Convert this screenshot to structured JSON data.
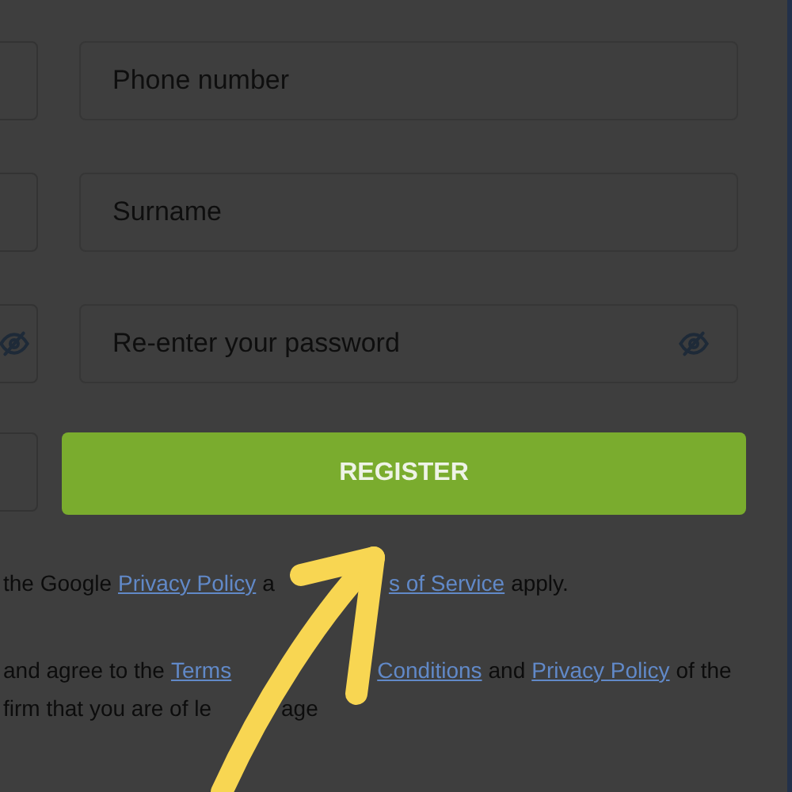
{
  "left_fields": [
    {
      "kind": "plain"
    },
    {
      "kind": "plain"
    },
    {
      "kind": "password"
    },
    {
      "kind": "plain"
    }
  ],
  "fields": [
    {
      "kind": "text",
      "placeholder": "Phone number"
    },
    {
      "kind": "text",
      "placeholder": "Surname"
    },
    {
      "kind": "password",
      "placeholder": "Re-enter your password"
    }
  ],
  "register_button": "REGISTER",
  "notes": [
    [
      {
        "kind": "text",
        "text": "the Google"
      },
      {
        "kind": "link",
        "text": "Privacy Policy"
      },
      {
        "kind": "text",
        "text": "a"
      },
      {
        "kind": "gap"
      },
      {
        "kind": "link",
        "text": "s of Service"
      },
      {
        "kind": "text",
        "text": "apply."
      }
    ],
    [
      {
        "kind": "text",
        "text": "and agree to the"
      },
      {
        "kind": "link",
        "text": "Terms"
      },
      {
        "kind": "gap"
      },
      {
        "kind": "link",
        "text": "Conditions"
      },
      {
        "kind": "text",
        "text": "and"
      },
      {
        "kind": "link",
        "text": "Privacy Policy"
      },
      {
        "kind": "text",
        "text": "of the"
      }
    ],
    [
      {
        "kind": "text",
        "text": "firm that you are of le"
      },
      {
        "kind": "gap"
      },
      {
        "kind": "text",
        "text": "age"
      }
    ]
  ]
}
